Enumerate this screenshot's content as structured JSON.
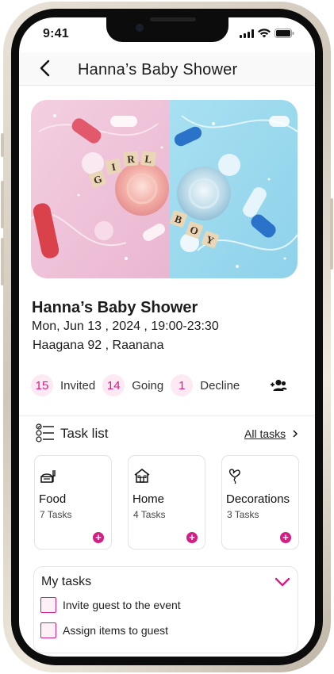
{
  "status": {
    "time": "9:41"
  },
  "header": {
    "title": "Hanna’s Baby Shower"
  },
  "event": {
    "title": "Hanna’s Baby Shower",
    "datetime": "Mon, Jun 13 , 2024 , 19:00-23:30",
    "address": "Haagana 92 , Raanana",
    "image_blocks": {
      "girl": [
        "G",
        "I",
        "R",
        "L"
      ],
      "boy": [
        "B",
        "O",
        "Y"
      ]
    }
  },
  "rsvp": [
    {
      "count": "15",
      "label": "Invited"
    },
    {
      "count": "14",
      "label": "Going"
    },
    {
      "count": "1",
      "label": "Decline"
    }
  ],
  "tasks": {
    "title": "Task list",
    "all_link": "All tasks",
    "categories": [
      {
        "name": "Food",
        "count": "7 Tasks",
        "icon": "food-icon"
      },
      {
        "name": "Home",
        "count": "4 Tasks",
        "icon": "home-icon"
      },
      {
        "name": "Decorations",
        "count": "3 Tasks",
        "icon": "balloon-icon"
      }
    ]
  },
  "my_tasks": {
    "title": "My tasks",
    "items": [
      "Invite guest to the event",
      "Assign items to guest"
    ]
  },
  "colors": {
    "accent": "#d61d84",
    "accent_light": "#fde9f3",
    "hero_pink": "#f1c6dc",
    "hero_blue": "#9fdcf0"
  }
}
